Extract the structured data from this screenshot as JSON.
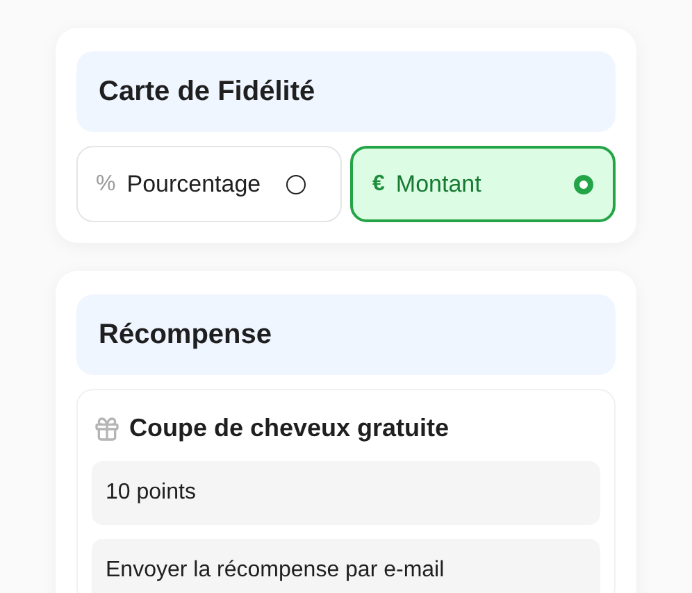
{
  "loyalty_card": {
    "title": "Carte de Fidélité",
    "options": [
      {
        "symbol": "%",
        "label": "Pourcentage",
        "selected": false
      },
      {
        "symbol": "€",
        "label": "Montant",
        "selected": true
      }
    ]
  },
  "reward": {
    "title": "Récompense",
    "item": {
      "title": "Coupe de cheveux gratuite",
      "fields": [
        {
          "value": "10 points"
        },
        {
          "value": "Envoyer la récompense par e-mail"
        }
      ]
    }
  }
}
